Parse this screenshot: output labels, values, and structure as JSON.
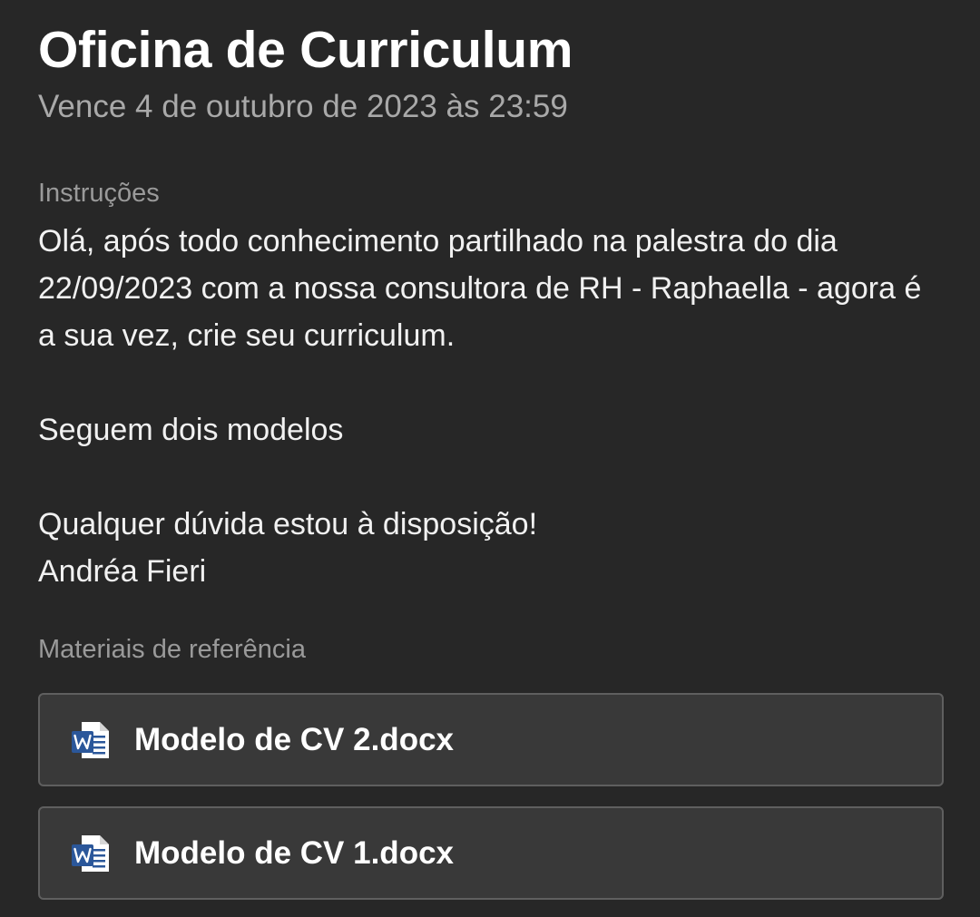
{
  "assignment": {
    "title": "Oficina de Curriculum",
    "due": "Vence 4 de outubro de 2023 às 23:59"
  },
  "instructions": {
    "label": "Instruções",
    "paragraphs": [
      "Olá, após todo conhecimento partilhado na palestra do dia 22/09/2023 com a nossa consultora de RH - Raphaella - agora é a sua vez, crie seu curriculum.",
      "Seguem dois modelos",
      "Qualquer dúvida estou à disposição!",
      "Andréa Fieri"
    ]
  },
  "materials": {
    "label": "Materiais de referência",
    "items": [
      {
        "name": "Modelo de CV 2.docx",
        "icon": "word-document-icon"
      },
      {
        "name": "Modelo de CV 1.docx",
        "icon": "word-document-icon"
      }
    ]
  },
  "colors": {
    "background": "#272727",
    "card_background": "#393939",
    "card_border": "#5f5f5f",
    "word_blue": "#2b579a"
  }
}
